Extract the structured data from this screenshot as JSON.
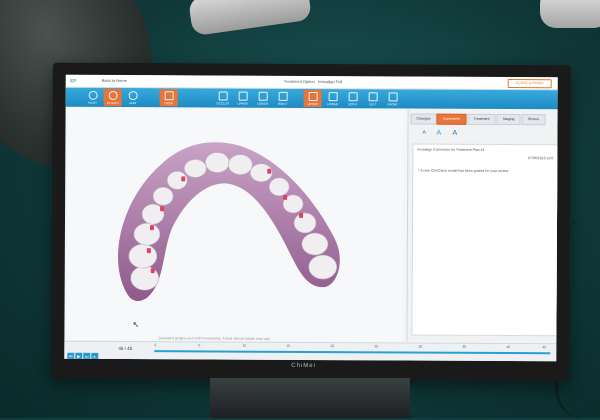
{
  "app": {
    "logo": "ign",
    "back": "Back to Home",
    "title": "Treatment Option",
    "subtitle": "Invisalign Full",
    "right_button": "CLOSE & FINISH"
  },
  "toolbar": {
    "items": [
      "PILOT",
      "ATTACH",
      "NUM",
      "OVER",
      "OCCLUS",
      "UPPER",
      "LOWER",
      "RIGHT",
      "UPPER",
      "LOWER",
      "BOTH",
      "LEFT",
      "FRONT"
    ]
  },
  "viewer": {
    "caption": "Simulated gingiva and tooth movements. Actual clinical results may vary."
  },
  "panel": {
    "tabs": [
      "Changes",
      "Comments",
      "Treatment",
      "Staging",
      "Photos"
    ],
    "comment_title": "Invisalign Comments for Treatment Plan #4",
    "comment_date": "07/06/2016 10:0",
    "comment_message": "* A new ClinCheck model has been posted for your review."
  },
  "timeline": {
    "counter": "45 / 45",
    "ticks": [
      "0",
      "5",
      "10",
      "15",
      "20",
      "25",
      "30",
      "35",
      "40",
      "45"
    ]
  },
  "monitor": {
    "brand": "ChiMei"
  },
  "colors": {
    "accent": "#1e8bc3",
    "active": "#e7743a"
  }
}
